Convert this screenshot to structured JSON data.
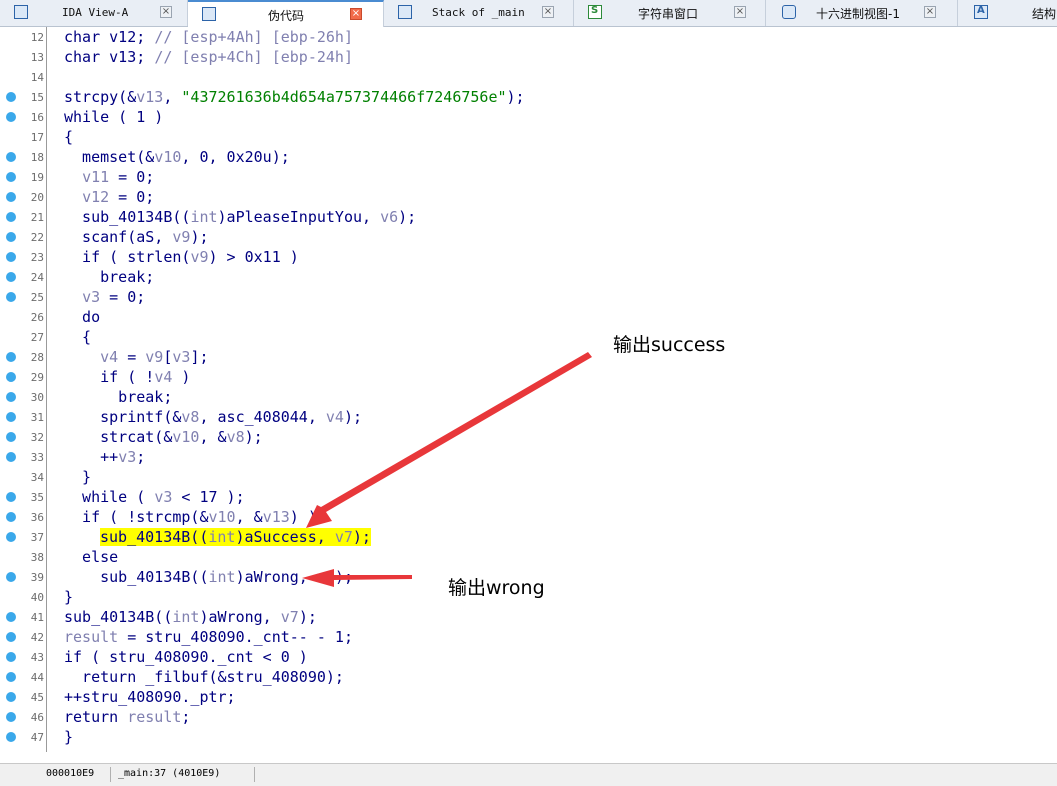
{
  "tabs": [
    {
      "label": "IDA View-A",
      "icon": "ida-view-icon",
      "active": false
    },
    {
      "label": "伪代码",
      "icon": "pseudocode-icon",
      "active": true
    },
    {
      "label": "Stack of _main",
      "icon": "stack-icon",
      "active": false
    },
    {
      "label": "字符串窗口",
      "icon": "strings-icon",
      "active": false
    },
    {
      "label": "十六进制视图-1",
      "icon": "hex-view-icon",
      "active": false
    },
    {
      "label": "结构",
      "icon": "structures-icon",
      "active": false
    }
  ],
  "colors": {
    "breakpoint_dot": "#3aa8ea",
    "highlight": "#ffff00",
    "arrow": "#e8373a",
    "keyword": "#000080",
    "variable": "#8080b0",
    "string": "#008000"
  },
  "code_lines": [
    {
      "n": "12",
      "dot": false,
      "parts": [
        [
          "t",
          "char v12; "
        ],
        [
          "c",
          "// [esp+4Ah] [ebp-26h]"
        ]
      ]
    },
    {
      "n": "13",
      "dot": false,
      "parts": [
        [
          "t",
          "char v13; "
        ],
        [
          "c",
          "// [esp+4Ch] [ebp-24h]"
        ]
      ]
    },
    {
      "n": "14",
      "dot": false,
      "parts": []
    },
    {
      "n": "15",
      "dot": true,
      "parts": [
        [
          "t",
          "strcpy(&"
        ],
        [
          "v",
          "v13"
        ],
        [
          "t",
          ", "
        ],
        [
          "s",
          "\"437261636b4d654a757374466f7246756e\""
        ],
        [
          "t",
          ");"
        ]
      ]
    },
    {
      "n": "16",
      "dot": true,
      "parts": [
        [
          "t",
          "while ( 1 )"
        ]
      ]
    },
    {
      "n": "17",
      "dot": false,
      "parts": [
        [
          "t",
          "{"
        ]
      ]
    },
    {
      "n": "18",
      "dot": true,
      "parts": [
        [
          "t",
          "  memset(&"
        ],
        [
          "v",
          "v10"
        ],
        [
          "t",
          ", 0, 0x20u);"
        ]
      ]
    },
    {
      "n": "19",
      "dot": true,
      "parts": [
        [
          "t",
          "  "
        ],
        [
          "v",
          "v11"
        ],
        [
          "t",
          " = 0;"
        ]
      ]
    },
    {
      "n": "20",
      "dot": true,
      "parts": [
        [
          "t",
          "  "
        ],
        [
          "v",
          "v12"
        ],
        [
          "t",
          " = 0;"
        ]
      ]
    },
    {
      "n": "21",
      "dot": true,
      "parts": [
        [
          "t",
          "  sub_40134B(("
        ],
        [
          "v",
          "int"
        ],
        [
          "t",
          ")aPleaseInputYou, "
        ],
        [
          "v",
          "v6"
        ],
        [
          "t",
          ");"
        ]
      ]
    },
    {
      "n": "22",
      "dot": true,
      "parts": [
        [
          "t",
          "  scanf(aS, "
        ],
        [
          "v",
          "v9"
        ],
        [
          "t",
          ");"
        ]
      ]
    },
    {
      "n": "23",
      "dot": true,
      "parts": [
        [
          "t",
          "  if ( strlen("
        ],
        [
          "v",
          "v9"
        ],
        [
          "t",
          ") > 0x11 )"
        ]
      ]
    },
    {
      "n": "24",
      "dot": true,
      "parts": [
        [
          "t",
          "    break;"
        ]
      ]
    },
    {
      "n": "25",
      "dot": true,
      "parts": [
        [
          "t",
          "  "
        ],
        [
          "v",
          "v3"
        ],
        [
          "t",
          " = 0;"
        ]
      ]
    },
    {
      "n": "26",
      "dot": false,
      "parts": [
        [
          "t",
          "  do"
        ]
      ]
    },
    {
      "n": "27",
      "dot": false,
      "parts": [
        [
          "t",
          "  {"
        ]
      ]
    },
    {
      "n": "28",
      "dot": true,
      "parts": [
        [
          "t",
          "    "
        ],
        [
          "v",
          "v4"
        ],
        [
          "t",
          " = "
        ],
        [
          "v",
          "v9"
        ],
        [
          "t",
          "["
        ],
        [
          "v",
          "v3"
        ],
        [
          "t",
          "];"
        ]
      ]
    },
    {
      "n": "29",
      "dot": true,
      "parts": [
        [
          "t",
          "    if ( !"
        ],
        [
          "v",
          "v4"
        ],
        [
          "t",
          " )"
        ]
      ]
    },
    {
      "n": "30",
      "dot": true,
      "parts": [
        [
          "t",
          "      break;"
        ]
      ]
    },
    {
      "n": "31",
      "dot": true,
      "parts": [
        [
          "t",
          "    sprintf(&"
        ],
        [
          "v",
          "v8"
        ],
        [
          "t",
          ", asc_408044, "
        ],
        [
          "v",
          "v4"
        ],
        [
          "t",
          ");"
        ]
      ]
    },
    {
      "n": "32",
      "dot": true,
      "parts": [
        [
          "t",
          "    strcat(&"
        ],
        [
          "v",
          "v10"
        ],
        [
          "t",
          ", &"
        ],
        [
          "v",
          "v8"
        ],
        [
          "t",
          ");"
        ]
      ]
    },
    {
      "n": "33",
      "dot": true,
      "parts": [
        [
          "t",
          "    ++"
        ],
        [
          "v",
          "v3"
        ],
        [
          "t",
          ";"
        ]
      ]
    },
    {
      "n": "34",
      "dot": false,
      "parts": [
        [
          "t",
          "  }"
        ]
      ]
    },
    {
      "n": "35",
      "dot": true,
      "parts": [
        [
          "t",
          "  while ( "
        ],
        [
          "v",
          "v3"
        ],
        [
          "t",
          " < 17 );"
        ]
      ]
    },
    {
      "n": "36",
      "dot": true,
      "parts": [
        [
          "t",
          "  if ( !strcmp(&"
        ],
        [
          "v",
          "v10"
        ],
        [
          "t",
          ", &"
        ],
        [
          "v",
          "v13"
        ],
        [
          "t",
          ") )"
        ]
      ]
    },
    {
      "n": "37",
      "dot": true,
      "highlight": true,
      "parts": [
        [
          "t",
          "sub_40134B(("
        ],
        [
          "v",
          "int"
        ],
        [
          "t",
          ")aSuccess, "
        ],
        [
          "v",
          "v7"
        ],
        [
          "t",
          ");"
        ]
      ]
    },
    {
      "n": "38",
      "dot": false,
      "parts": [
        [
          "t",
          "  else"
        ]
      ]
    },
    {
      "n": "39",
      "dot": true,
      "parts": [
        [
          "t",
          "    sub_40134B(("
        ],
        [
          "v",
          "int"
        ],
        [
          "t",
          ")aWrong, "
        ],
        [
          "v",
          "v7"
        ],
        [
          "t",
          ");"
        ]
      ]
    },
    {
      "n": "40",
      "dot": false,
      "parts": [
        [
          "t",
          "}"
        ]
      ]
    },
    {
      "n": "41",
      "dot": true,
      "parts": [
        [
          "t",
          "sub_40134B(("
        ],
        [
          "v",
          "int"
        ],
        [
          "t",
          ")aWrong, "
        ],
        [
          "v",
          "v7"
        ],
        [
          "t",
          ");"
        ]
      ]
    },
    {
      "n": "42",
      "dot": true,
      "parts": [
        [
          "v",
          "result"
        ],
        [
          "t",
          " = stru_408090._cnt-- - 1;"
        ]
      ]
    },
    {
      "n": "43",
      "dot": true,
      "parts": [
        [
          "t",
          "if ( stru_408090._cnt < 0 )"
        ]
      ]
    },
    {
      "n": "44",
      "dot": true,
      "parts": [
        [
          "t",
          "  return _filbuf(&stru_408090);"
        ]
      ]
    },
    {
      "n": "45",
      "dot": true,
      "parts": [
        [
          "t",
          "++stru_408090._ptr;"
        ]
      ]
    },
    {
      "n": "46",
      "dot": true,
      "parts": [
        [
          "t",
          "return "
        ],
        [
          "v",
          "result"
        ],
        [
          "t",
          ";"
        ]
      ]
    },
    {
      "n": "47",
      "dot": true,
      "parts": [
        [
          "t",
          "}"
        ]
      ]
    }
  ],
  "annotations": {
    "success_label": "输出success",
    "wrong_label": "输出wrong"
  },
  "statusbar": {
    "offset": "000010E9",
    "location": "_main:37 (4010E9)"
  }
}
